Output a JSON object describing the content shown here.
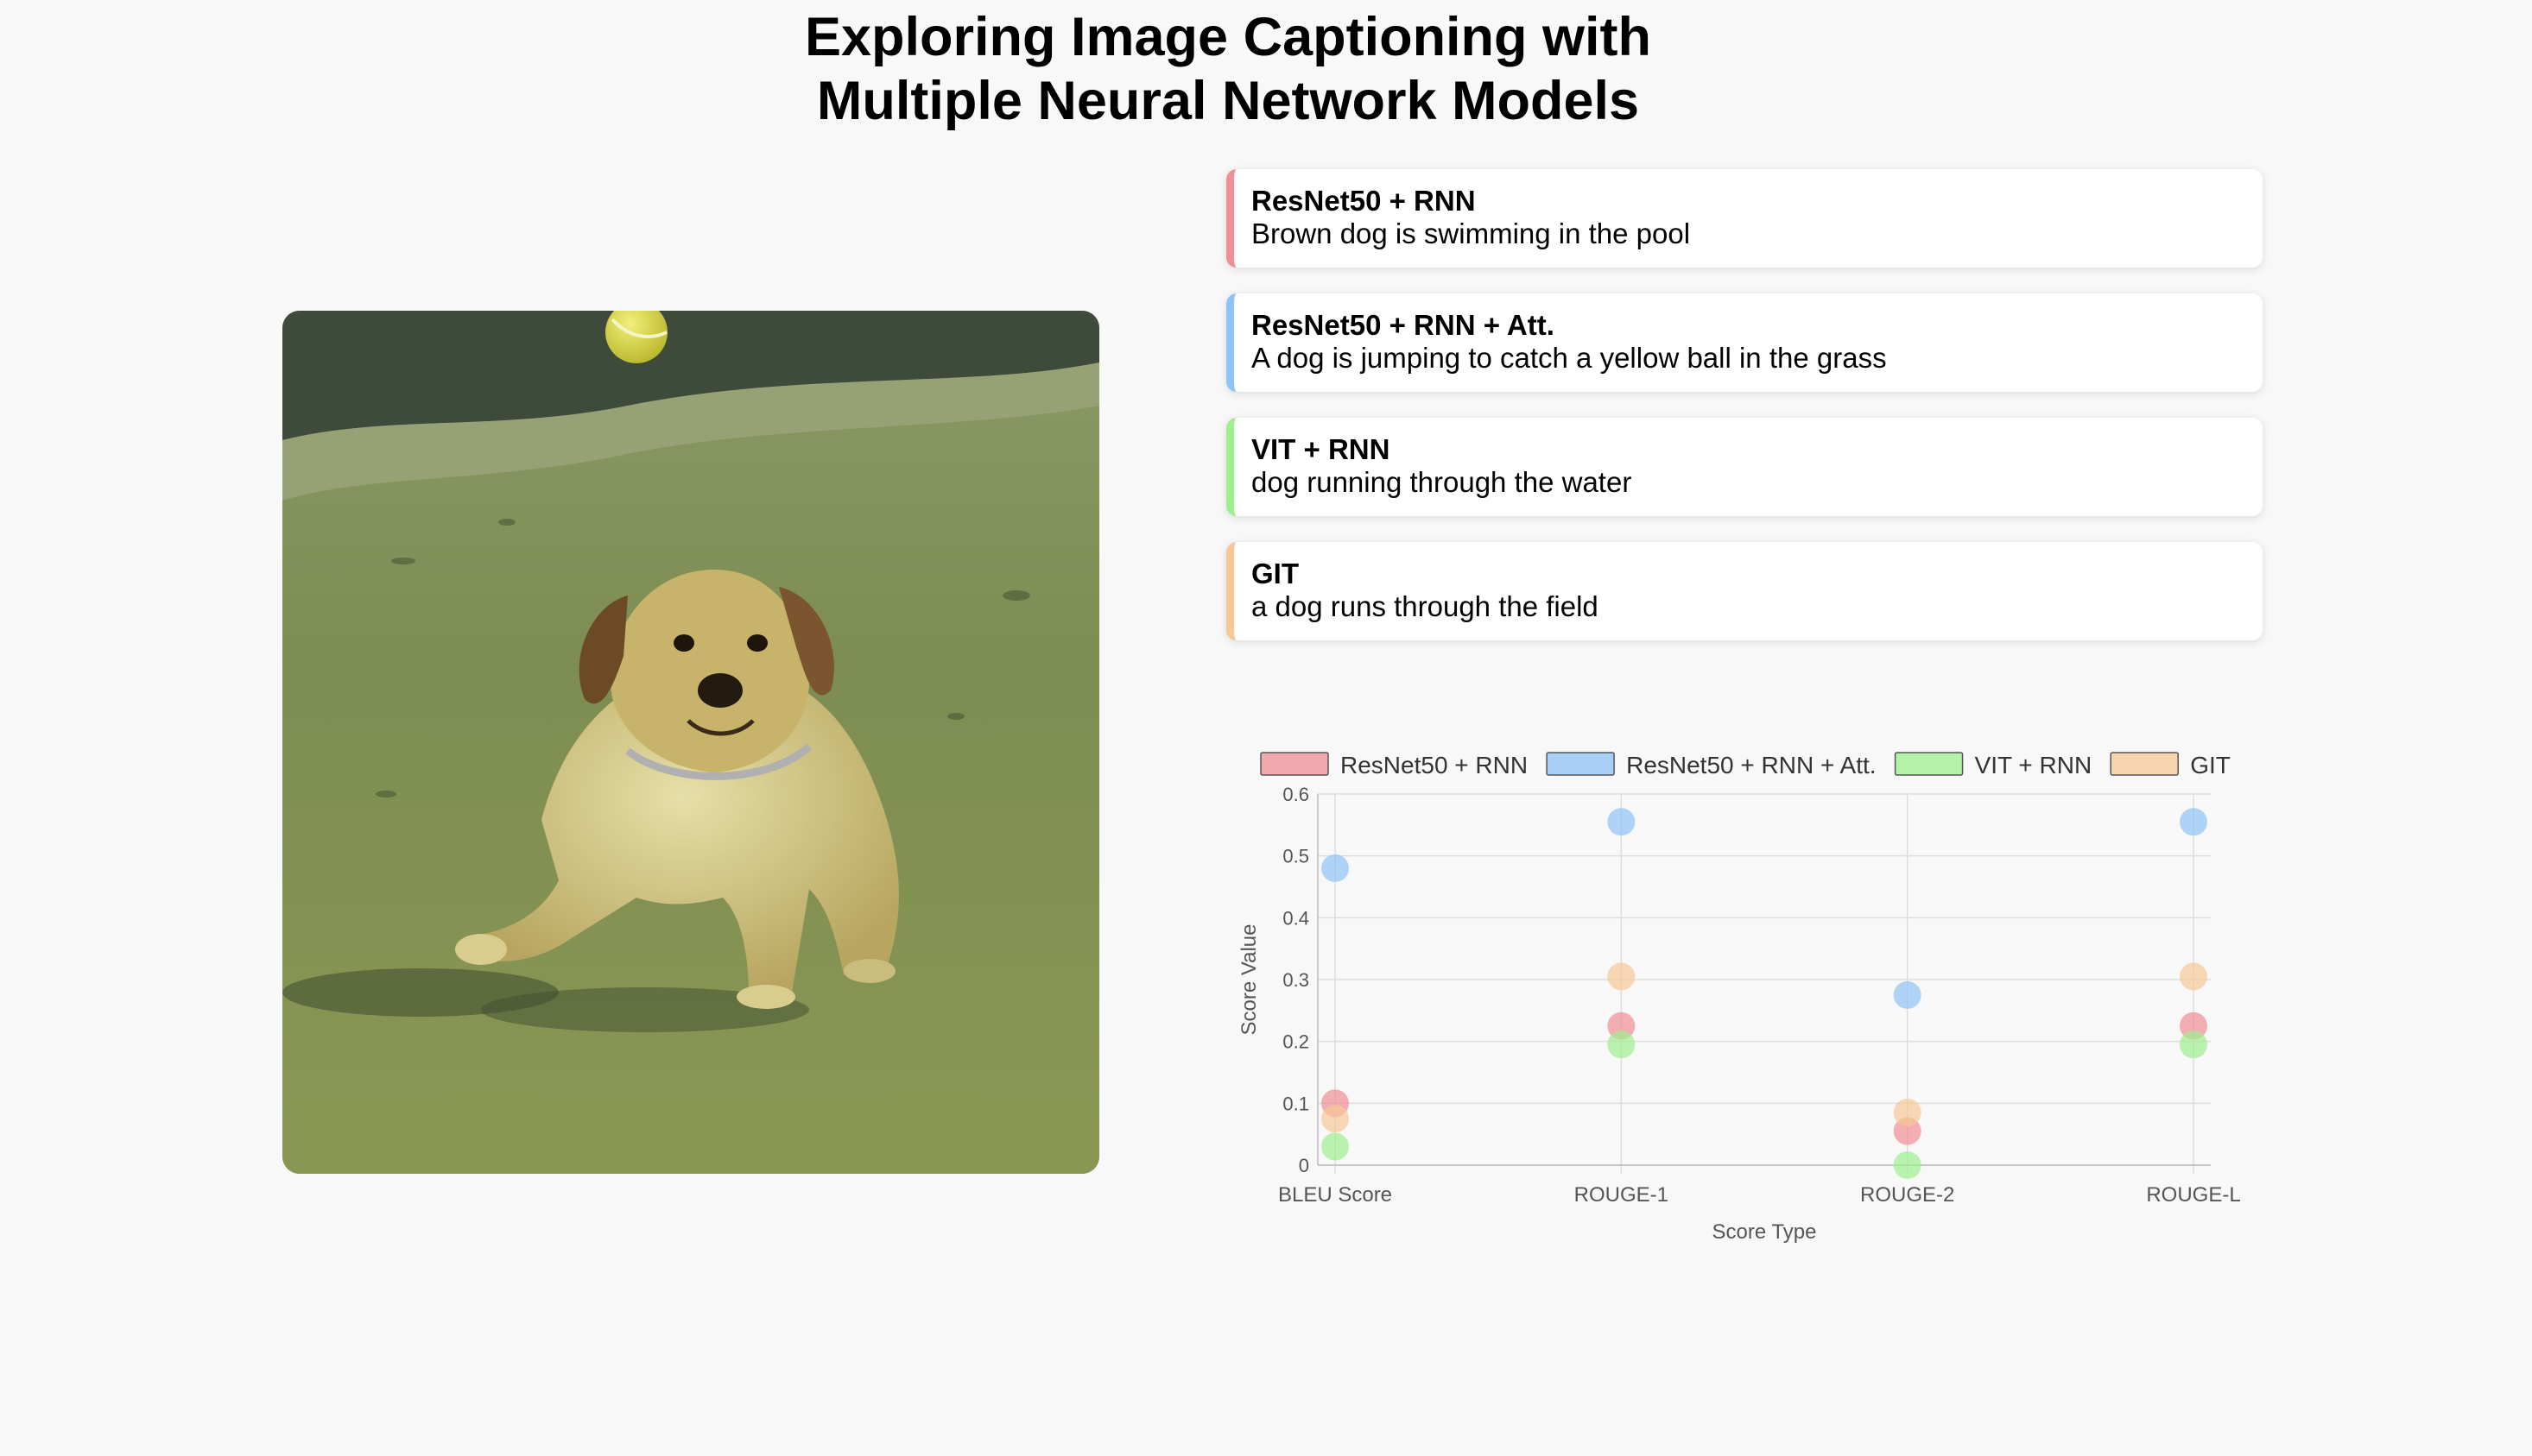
{
  "page": {
    "title_line1": "Exploring Image Captioning with",
    "title_line2": "Multiple Neural Network Models"
  },
  "image": {
    "subject": "dog-jumping-for-ball-photo"
  },
  "captions": [
    {
      "model": "ResNet50 + RNN",
      "text": "Brown dog is swimming in the pool",
      "color": "#f08f96"
    },
    {
      "model": "ResNet50 + RNN + Att.",
      "text": "A dog is jumping to catch a yellow ball in the grass",
      "color": "#8ec3f7"
    },
    {
      "model": "VIT + RNN",
      "text": "dog running through the water",
      "color": "#9ef08e"
    },
    {
      "model": "GIT",
      "text": "a dog runs through the field",
      "color": "#f6c896"
    }
  ],
  "chart_data": {
    "type": "scatter",
    "title": "",
    "xlabel": "Score Type",
    "ylabel": "Score Value",
    "categories": [
      "BLEU Score",
      "ROUGE-1",
      "ROUGE-2",
      "ROUGE-L"
    ],
    "ylim": [
      0,
      0.6
    ],
    "yticks": [
      "0",
      "0.1",
      "0.2",
      "0.3",
      "0.4",
      "0.5",
      "0.6"
    ],
    "grid": true,
    "legend_position": "top",
    "series": [
      {
        "name": "ResNet50 + RNN",
        "color": "#f08f96",
        "values": [
          0.1,
          0.225,
          0.055,
          0.225
        ]
      },
      {
        "name": "ResNet50 + RNN + Att.",
        "color": "#8ec3f7",
        "values": [
          0.48,
          0.555,
          0.275,
          0.555
        ]
      },
      {
        "name": "VIT + RNN",
        "color": "#9ef08e",
        "values": [
          0.03,
          0.195,
          0.0,
          0.195
        ]
      },
      {
        "name": "GIT",
        "color": "#f6c896",
        "values": [
          0.075,
          0.305,
          0.085,
          0.305
        ]
      }
    ]
  }
}
